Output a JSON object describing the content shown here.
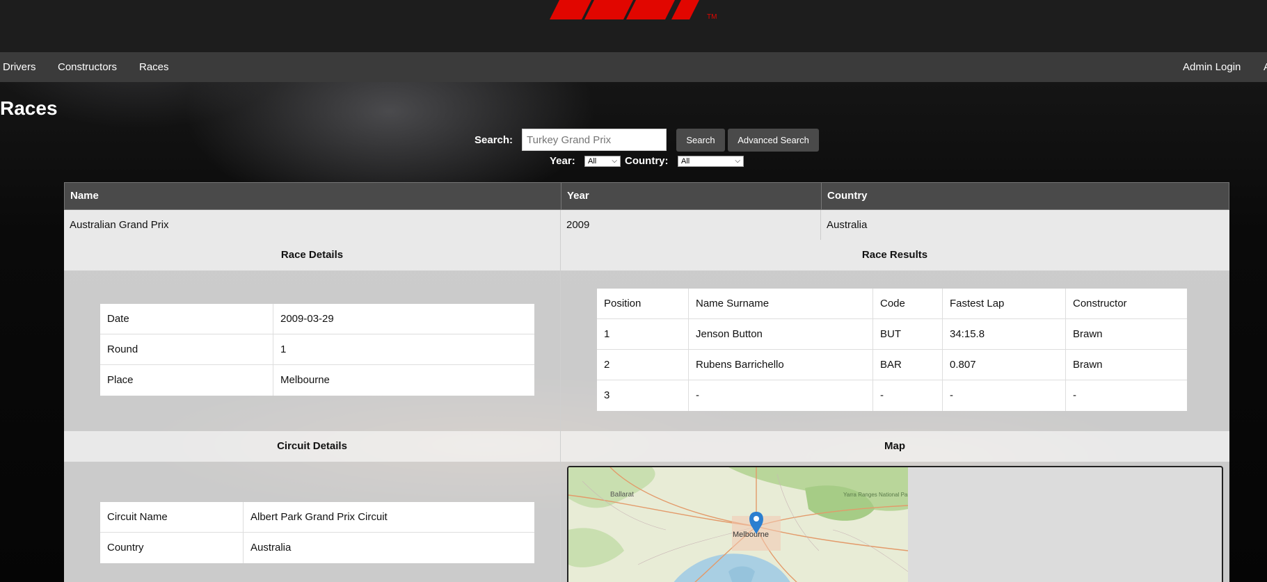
{
  "nav": {
    "items": [
      "Drivers",
      "Constructors",
      "Races"
    ],
    "admin_login": "Admin Login",
    "overflow": "A"
  },
  "logo": {
    "trademark": "TM"
  },
  "page": {
    "title": "Races"
  },
  "search": {
    "label": "Search:",
    "placeholder": "Turkey Grand Prix",
    "value": "",
    "search_button": "Search",
    "advanced_button": "Advanced Search",
    "year_label": "Year:",
    "year_value": "All",
    "country_label": "Country:",
    "country_value": "All"
  },
  "races_table": {
    "headers": [
      "Name",
      "Year",
      "Country"
    ],
    "row": [
      "Australian Grand Prix",
      "2009",
      "Australia"
    ]
  },
  "race_details": {
    "title": "Race Details",
    "rows": [
      [
        "Date",
        "2009-03-29"
      ],
      [
        "Round",
        "1"
      ],
      [
        "Place",
        "Melbourne"
      ]
    ]
  },
  "race_results": {
    "title": "Race Results",
    "headers": [
      "Position",
      "Name Surname",
      "Code",
      "Fastest Lap",
      "Constructor"
    ],
    "rows": [
      [
        "1",
        "Jenson Button",
        "BUT",
        "34:15.8",
        "Brawn"
      ],
      [
        "2",
        "Rubens Barrichello",
        "BAR",
        "0.807",
        "Brawn"
      ],
      [
        "3",
        "-",
        "-",
        "-",
        "-"
      ]
    ]
  },
  "circuit_details": {
    "title": "Circuit Details",
    "rows": [
      [
        "Circuit Name",
        "Albert Park Grand Prix Circuit"
      ],
      [
        "Country",
        "Australia"
      ]
    ]
  },
  "map": {
    "title": "Map",
    "labels": {
      "city": "Melbourne",
      "town": "Ballarat",
      "park": "Yarra Ranges National Park"
    },
    "colors": {
      "land": "#e8ecd6",
      "forest": "#b9d69a",
      "water": "#a9cfe3",
      "roads": "#e39a6a",
      "marker": "#2b7fd0"
    }
  },
  "colors": {
    "brand_red": "#e10600",
    "navbar": "#3b3b3b",
    "header": "#4a4a4a"
  }
}
